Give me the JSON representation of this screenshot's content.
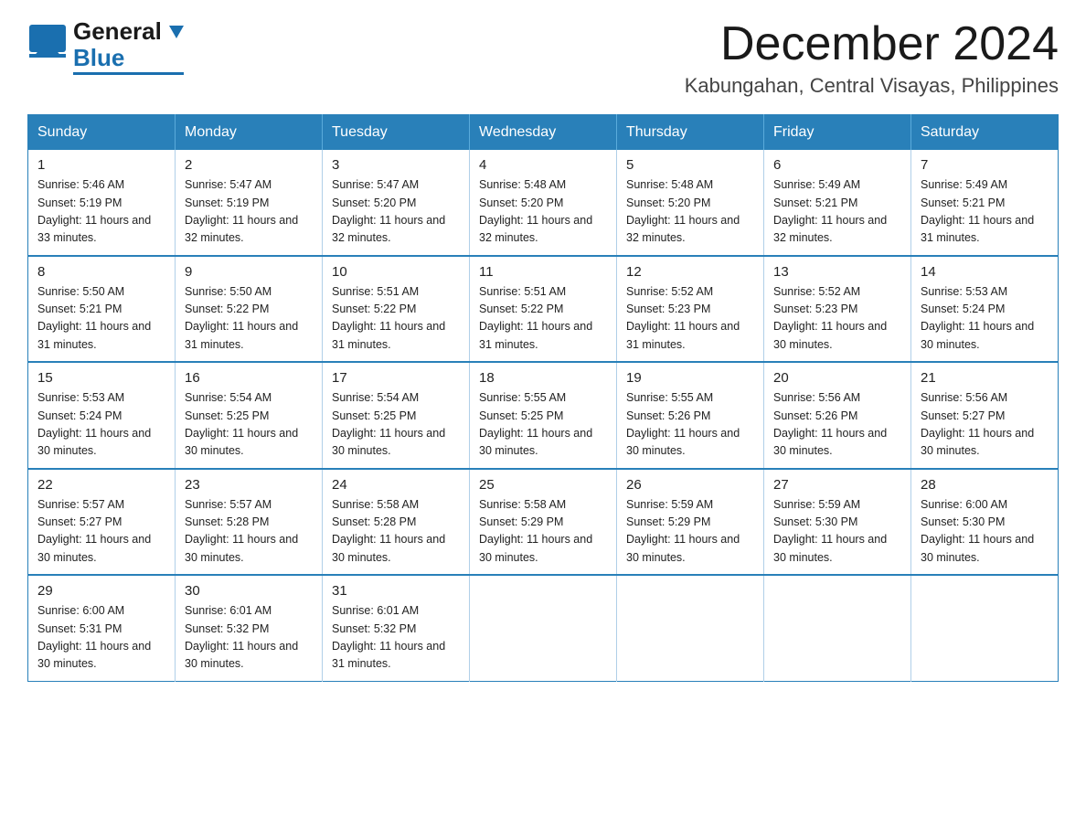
{
  "header": {
    "logo_general": "General",
    "logo_blue": "Blue",
    "month_title": "December 2024",
    "location": "Kabungahan, Central Visayas, Philippines"
  },
  "calendar": {
    "days_of_week": [
      "Sunday",
      "Monday",
      "Tuesday",
      "Wednesday",
      "Thursday",
      "Friday",
      "Saturday"
    ],
    "weeks": [
      [
        {
          "day": "1",
          "sunrise": "Sunrise: 5:46 AM",
          "sunset": "Sunset: 5:19 PM",
          "daylight": "Daylight: 11 hours and 33 minutes."
        },
        {
          "day": "2",
          "sunrise": "Sunrise: 5:47 AM",
          "sunset": "Sunset: 5:19 PM",
          "daylight": "Daylight: 11 hours and 32 minutes."
        },
        {
          "day": "3",
          "sunrise": "Sunrise: 5:47 AM",
          "sunset": "Sunset: 5:20 PM",
          "daylight": "Daylight: 11 hours and 32 minutes."
        },
        {
          "day": "4",
          "sunrise": "Sunrise: 5:48 AM",
          "sunset": "Sunset: 5:20 PM",
          "daylight": "Daylight: 11 hours and 32 minutes."
        },
        {
          "day": "5",
          "sunrise": "Sunrise: 5:48 AM",
          "sunset": "Sunset: 5:20 PM",
          "daylight": "Daylight: 11 hours and 32 minutes."
        },
        {
          "day": "6",
          "sunrise": "Sunrise: 5:49 AM",
          "sunset": "Sunset: 5:21 PM",
          "daylight": "Daylight: 11 hours and 32 minutes."
        },
        {
          "day": "7",
          "sunrise": "Sunrise: 5:49 AM",
          "sunset": "Sunset: 5:21 PM",
          "daylight": "Daylight: 11 hours and 31 minutes."
        }
      ],
      [
        {
          "day": "8",
          "sunrise": "Sunrise: 5:50 AM",
          "sunset": "Sunset: 5:21 PM",
          "daylight": "Daylight: 11 hours and 31 minutes."
        },
        {
          "day": "9",
          "sunrise": "Sunrise: 5:50 AM",
          "sunset": "Sunset: 5:22 PM",
          "daylight": "Daylight: 11 hours and 31 minutes."
        },
        {
          "day": "10",
          "sunrise": "Sunrise: 5:51 AM",
          "sunset": "Sunset: 5:22 PM",
          "daylight": "Daylight: 11 hours and 31 minutes."
        },
        {
          "day": "11",
          "sunrise": "Sunrise: 5:51 AM",
          "sunset": "Sunset: 5:22 PM",
          "daylight": "Daylight: 11 hours and 31 minutes."
        },
        {
          "day": "12",
          "sunrise": "Sunrise: 5:52 AM",
          "sunset": "Sunset: 5:23 PM",
          "daylight": "Daylight: 11 hours and 31 minutes."
        },
        {
          "day": "13",
          "sunrise": "Sunrise: 5:52 AM",
          "sunset": "Sunset: 5:23 PM",
          "daylight": "Daylight: 11 hours and 30 minutes."
        },
        {
          "day": "14",
          "sunrise": "Sunrise: 5:53 AM",
          "sunset": "Sunset: 5:24 PM",
          "daylight": "Daylight: 11 hours and 30 minutes."
        }
      ],
      [
        {
          "day": "15",
          "sunrise": "Sunrise: 5:53 AM",
          "sunset": "Sunset: 5:24 PM",
          "daylight": "Daylight: 11 hours and 30 minutes."
        },
        {
          "day": "16",
          "sunrise": "Sunrise: 5:54 AM",
          "sunset": "Sunset: 5:25 PM",
          "daylight": "Daylight: 11 hours and 30 minutes."
        },
        {
          "day": "17",
          "sunrise": "Sunrise: 5:54 AM",
          "sunset": "Sunset: 5:25 PM",
          "daylight": "Daylight: 11 hours and 30 minutes."
        },
        {
          "day": "18",
          "sunrise": "Sunrise: 5:55 AM",
          "sunset": "Sunset: 5:25 PM",
          "daylight": "Daylight: 11 hours and 30 minutes."
        },
        {
          "day": "19",
          "sunrise": "Sunrise: 5:55 AM",
          "sunset": "Sunset: 5:26 PM",
          "daylight": "Daylight: 11 hours and 30 minutes."
        },
        {
          "day": "20",
          "sunrise": "Sunrise: 5:56 AM",
          "sunset": "Sunset: 5:26 PM",
          "daylight": "Daylight: 11 hours and 30 minutes."
        },
        {
          "day": "21",
          "sunrise": "Sunrise: 5:56 AM",
          "sunset": "Sunset: 5:27 PM",
          "daylight": "Daylight: 11 hours and 30 minutes."
        }
      ],
      [
        {
          "day": "22",
          "sunrise": "Sunrise: 5:57 AM",
          "sunset": "Sunset: 5:27 PM",
          "daylight": "Daylight: 11 hours and 30 minutes."
        },
        {
          "day": "23",
          "sunrise": "Sunrise: 5:57 AM",
          "sunset": "Sunset: 5:28 PM",
          "daylight": "Daylight: 11 hours and 30 minutes."
        },
        {
          "day": "24",
          "sunrise": "Sunrise: 5:58 AM",
          "sunset": "Sunset: 5:28 PM",
          "daylight": "Daylight: 11 hours and 30 minutes."
        },
        {
          "day": "25",
          "sunrise": "Sunrise: 5:58 AM",
          "sunset": "Sunset: 5:29 PM",
          "daylight": "Daylight: 11 hours and 30 minutes."
        },
        {
          "day": "26",
          "sunrise": "Sunrise: 5:59 AM",
          "sunset": "Sunset: 5:29 PM",
          "daylight": "Daylight: 11 hours and 30 minutes."
        },
        {
          "day": "27",
          "sunrise": "Sunrise: 5:59 AM",
          "sunset": "Sunset: 5:30 PM",
          "daylight": "Daylight: 11 hours and 30 minutes."
        },
        {
          "day": "28",
          "sunrise": "Sunrise: 6:00 AM",
          "sunset": "Sunset: 5:30 PM",
          "daylight": "Daylight: 11 hours and 30 minutes."
        }
      ],
      [
        {
          "day": "29",
          "sunrise": "Sunrise: 6:00 AM",
          "sunset": "Sunset: 5:31 PM",
          "daylight": "Daylight: 11 hours and 30 minutes."
        },
        {
          "day": "30",
          "sunrise": "Sunrise: 6:01 AM",
          "sunset": "Sunset: 5:32 PM",
          "daylight": "Daylight: 11 hours and 30 minutes."
        },
        {
          "day": "31",
          "sunrise": "Sunrise: 6:01 AM",
          "sunset": "Sunset: 5:32 PM",
          "daylight": "Daylight: 11 hours and 31 minutes."
        },
        null,
        null,
        null,
        null
      ]
    ]
  }
}
